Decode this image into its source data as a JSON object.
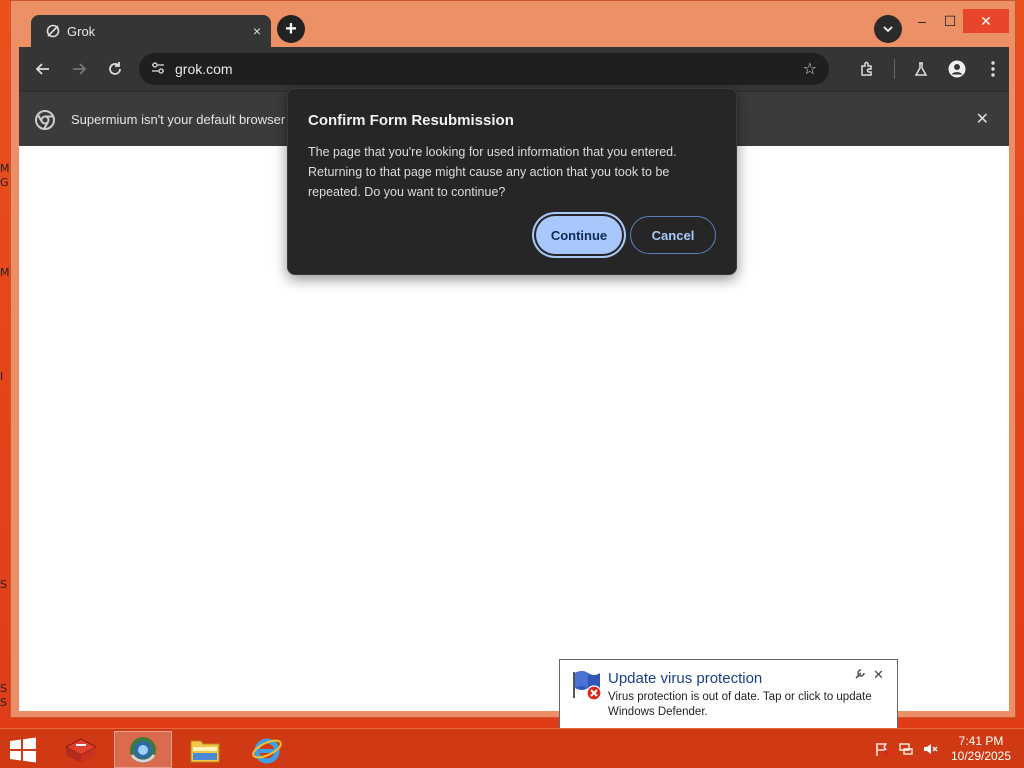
{
  "desktop": {
    "edge_letters": [
      "M",
      "G",
      "M",
      "I",
      "S",
      "S",
      "S"
    ]
  },
  "browser": {
    "tab_title": "Grok",
    "tab_close": "×",
    "newtab": "+",
    "url": "grok.com",
    "infobar_text": "Supermium isn't your default browser",
    "infobar_close": "✕",
    "window_controls": {
      "minimize": "–",
      "maximize": "☐",
      "close": "✕"
    }
  },
  "dialog": {
    "title": "Confirm Form Resubmission",
    "body": "The page that you're looking for used information that you entered. Returning to that page might cause any action that you took to be repeated. Do you want to continue?",
    "continue_label": "Continue",
    "cancel_label": "Cancel"
  },
  "notification": {
    "title": "Update virus protection",
    "text": "Virus protection is out of date. Tap or click to update Windows Defender.",
    "close": "✕"
  },
  "taskbar": {
    "time": "7:41 PM",
    "date": "10/29/2025"
  },
  "colors": {
    "desktop": "#e4431a",
    "dialog_bg": "#262626",
    "accent": "#a8c7fa"
  }
}
